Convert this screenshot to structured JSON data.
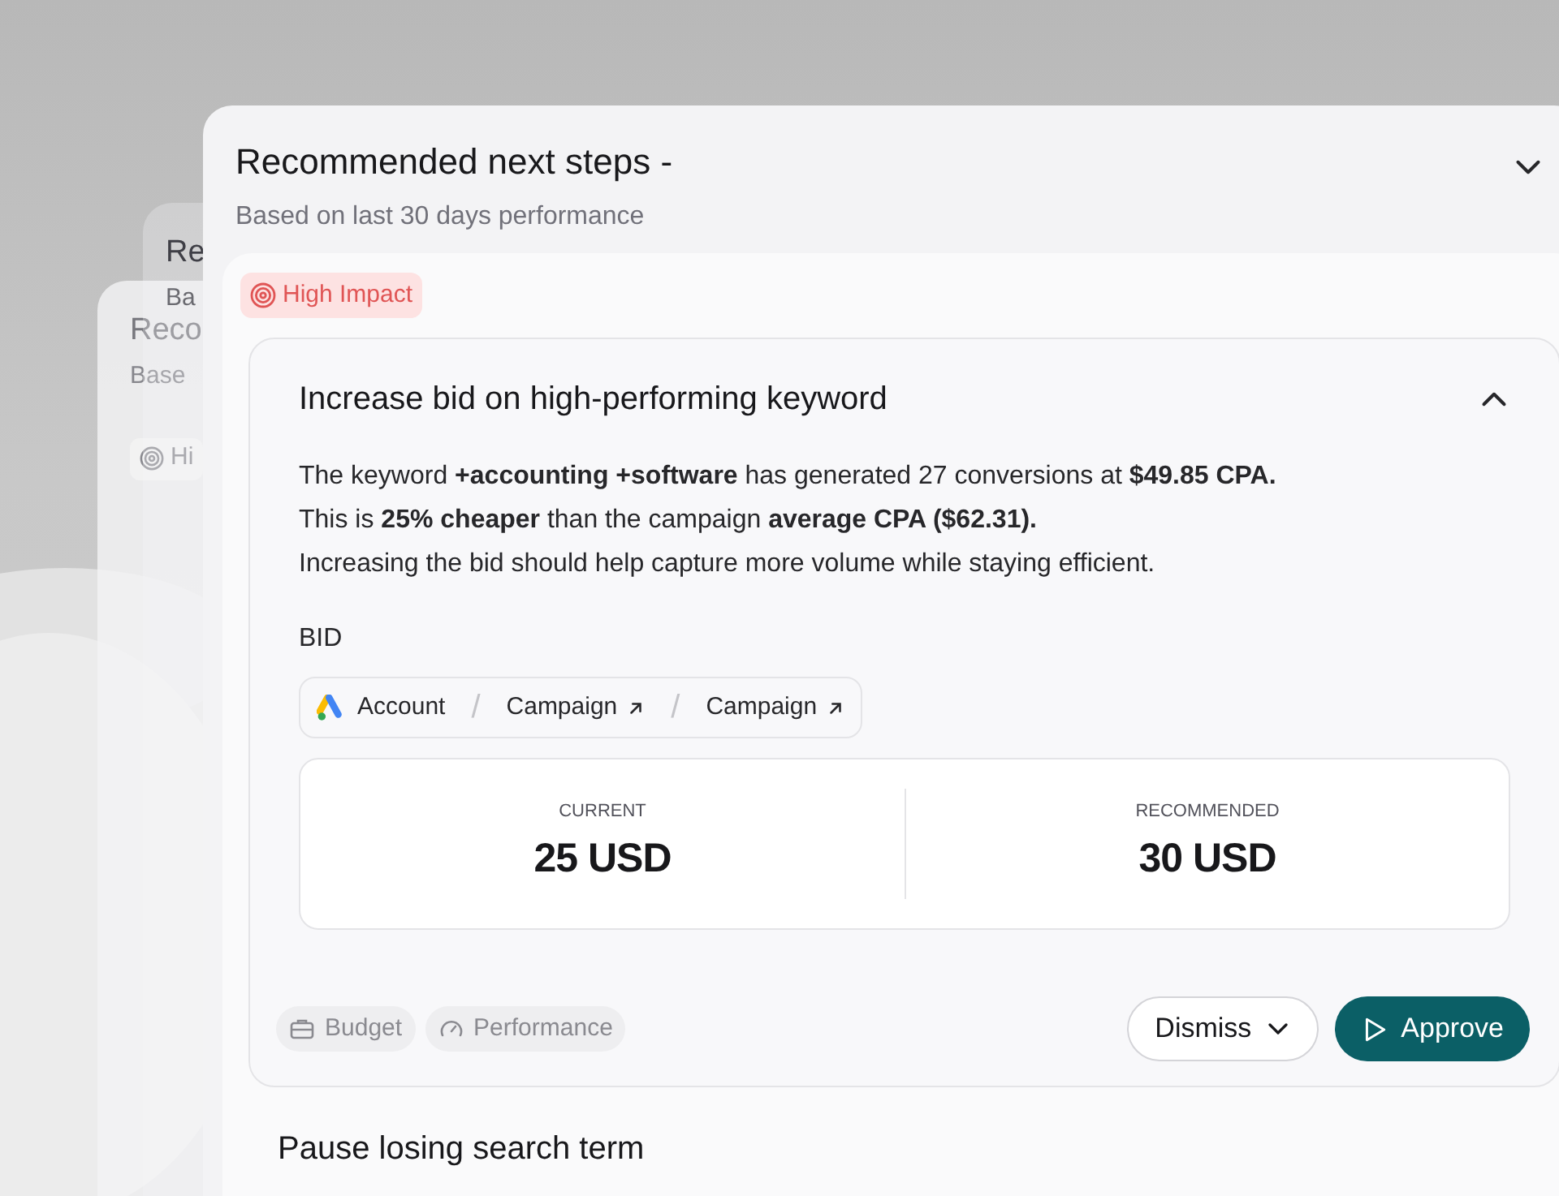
{
  "back_cards": [
    {
      "title": "Re",
      "subtitle": "Ba"
    },
    {
      "title": "Reco",
      "subtitle": "Base",
      "badge": "Hi"
    }
  ],
  "panel": {
    "title": "Recommended next steps -",
    "subtitle": "Based on last 30 days performance",
    "expanded": true
  },
  "impact_badge": "High Impact",
  "recommendations": [
    {
      "title": "Increase bid on high-performing keyword",
      "expanded": true,
      "body": [
        "The keyword **+accounting +software** has generated 27 conversions at **$49.85 CPA.**",
        "This is **25% cheaper** than the campaign **average CPA ($62.31).**",
        "Increasing the bid should help capture more volume while staying efficient."
      ],
      "section_label": "BID",
      "breadcrumb": [
        {
          "label": "Account",
          "kind": "root"
        },
        {
          "separator": "/",
          "label": "Campaign",
          "kind": "link"
        },
        {
          "separator": "/",
          "label": "Campaign",
          "kind": "link"
        }
      ],
      "values": [
        {
          "label": "CURRENT",
          "value": "25 USD"
        },
        {
          "label": "RECOMMENDED",
          "value": "30 USD"
        }
      ],
      "tags": [
        {
          "label": "Budget",
          "kind": "budget"
        },
        {
          "label": "Performance",
          "kind": "performance"
        }
      ],
      "actions": [
        {
          "label": "Dismiss",
          "kind": "dismiss"
        },
        {
          "label": "Approve",
          "kind": "approve"
        }
      ]
    },
    {
      "title": "Pause losing search term",
      "expanded": false
    }
  ]
}
